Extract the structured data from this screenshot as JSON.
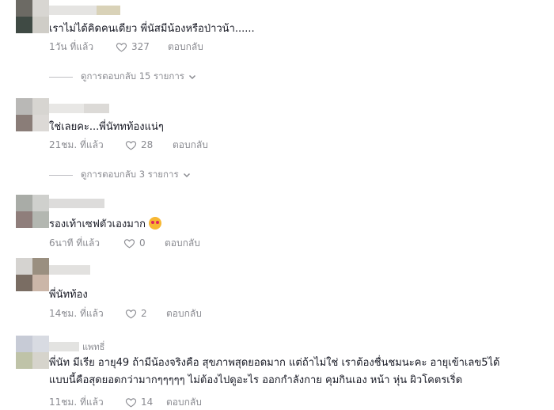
{
  "comments": [
    {
      "username": "",
      "text": "เราไม่ได้คิดคนเดียว พี่นัสมีน้องหรือป่าวน้า......",
      "time": "1วัน ที่แล้ว",
      "likes": "327",
      "reply_label": "ตอบกลับ",
      "view_replies": "ดูการตอบกลับ 15 รายการ",
      "avatar_colors": [
        "#6c6a64",
        "#d8d6d2",
        "#3f4a44",
        "#cfcdc7"
      ]
    },
    {
      "username": "",
      "text": "ใช่เลยคะ...พี่นัททท้องแน่ๆ",
      "time": "21ชม. ที่แล้ว",
      "likes": "28",
      "reply_label": "ตอบกลับ",
      "view_replies": "ดูการตอบกลับ 3 รายการ",
      "avatar_colors": [
        "#b9b8b6",
        "#d7d5d1",
        "#8a7d78",
        "#dcd9d6"
      ]
    },
    {
      "username": "",
      "text": "รองเท้าเซฟตัวเองมาก",
      "time": "6นาที ที่แล้ว",
      "likes": "0",
      "reply_label": "ตอบกลับ",
      "avatar_colors": [
        "#a9aca7",
        "#cfd0cd",
        "#8f7e7b",
        "#b3b7b1"
      ]
    },
    {
      "username": "",
      "text": "พี่นัทท้อง",
      "time": "14ชม. ที่แล้ว",
      "likes": "2",
      "reply_label": "ตอบกลับ",
      "avatar_colors": [
        "#d5d3d0",
        "#9a8f80",
        "#7a6d63",
        "#cbb6a8"
      ]
    },
    {
      "username": "แพทธี่",
      "text_lines": [
        "พี่นัท มีเรีย อายุ49 ถ้ามีน้องจริงคือ สุขภาพสุดยอดมาก แต่ถ้าไม่ใช่ เราต้องชื่นชมนะคะ อายุเข้าเลข5ได้",
        "แบบนี้คือสุดยอดกว่ามากๆๆๆๆๆ ไม่ต้องไปดูอะไร ออกกำลังกาย คุมกินเอง หน้า หุ่น ผิวโคตรเริ่ด"
      ],
      "time": "11ชม. ที่แล้ว",
      "likes": "14",
      "reply_label": "ตอบกลับ",
      "avatar_colors": [
        "#c7cbd6",
        "#d8dbe2",
        "#bfc3a8",
        "#d6d4cc"
      ]
    }
  ],
  "icons": {
    "like": "heart-outline-icon",
    "expand": "chevron-down-icon",
    "emoji": "smiling-face-with-hearts-icon"
  },
  "colors": {
    "text": "#161823",
    "muted": "#8a8b91"
  }
}
